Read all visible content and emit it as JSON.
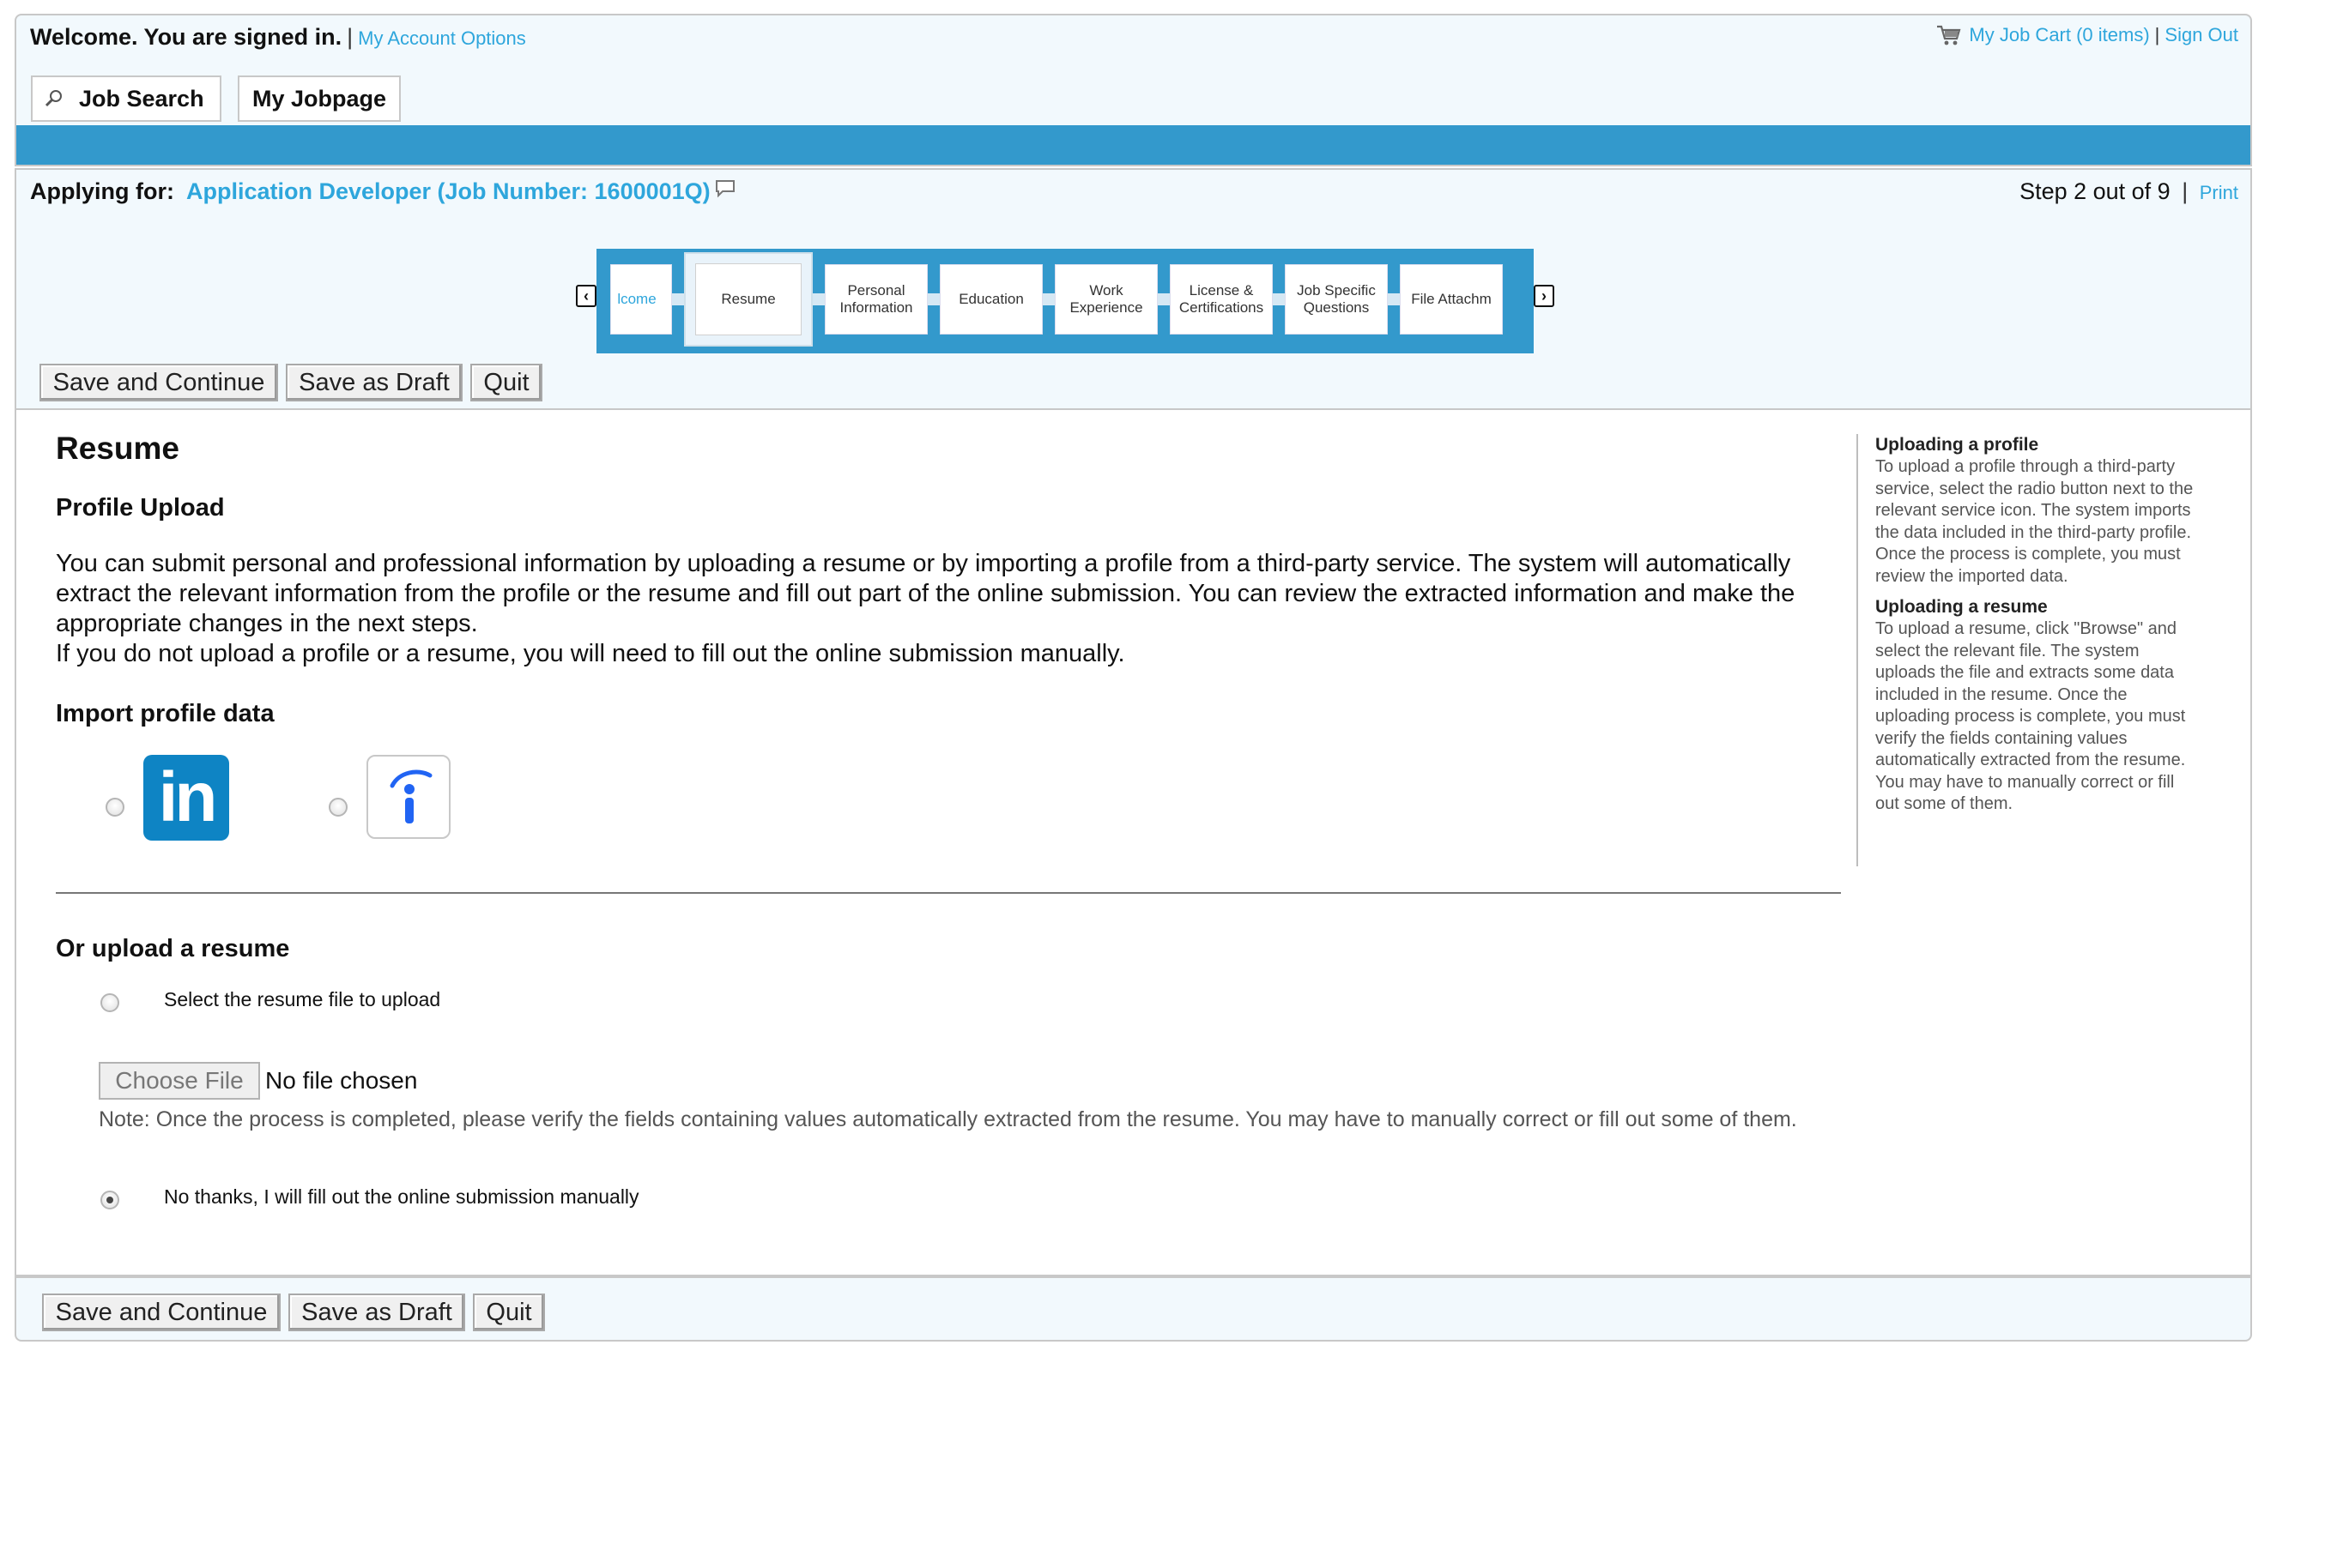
{
  "header": {
    "welcome": "Welcome. You are signed in.",
    "separator": "|",
    "account_options": "My Account Options",
    "job_cart": "My Job Cart (0 items)",
    "sign_out": "Sign Out",
    "tabs": [
      {
        "label": "Job Search",
        "icon": "magnifier-icon"
      },
      {
        "label": "My Jobpage"
      }
    ]
  },
  "apply": {
    "applying_for_label": "Applying for:",
    "job_title": "Application Developer (Job Number: 1600001Q)",
    "step_text": "Step 2 out of 9",
    "print": "Print"
  },
  "stepper": {
    "steps": [
      {
        "label": "lcome",
        "state": "visited"
      },
      {
        "label": "Resume",
        "state": "current"
      },
      {
        "label": "Personal Information"
      },
      {
        "label": "Education"
      },
      {
        "label": "Work Experience"
      },
      {
        "label": "License & Certifications"
      },
      {
        "label": "Job Specific Questions"
      },
      {
        "label": "File Attachm"
      }
    ]
  },
  "buttons": {
    "save_continue": "Save and Continue",
    "save_draft": "Save as Draft",
    "quit": "Quit"
  },
  "main": {
    "title": "Resume",
    "subtitle": "Profile Upload",
    "intro_1": "You can submit personal and professional information by uploading a resume or by importing a profile from a third-party service. The system will automatically extract the relevant information from the profile or the resume and fill out part of the online submission. You can review the extracted information and make the appropriate changes in the next steps.",
    "intro_2": "If you do not upload a profile or a resume, you will need to fill out the online submission manually.",
    "import_title": "Import profile data",
    "linkedin_text": "in",
    "upload_title": "Or upload a resume",
    "upload_option": "Select the resume file to upload",
    "choose_file": "Choose File",
    "no_file": "No file chosen",
    "note": "Note: Once the process is completed, please verify the fields containing values automatically extracted from the resume. You may have to manually correct or fill out some of them.",
    "manual_option": "No thanks, I will fill out the online submission manually"
  },
  "help": {
    "profile_title": "Uploading a profile",
    "profile_text": "To upload a profile through a third-party service, select the radio button next to the relevant service icon. The system imports the data included in the third-party profile. Once the process is complete, you must review the imported data.",
    "resume_title": "Uploading a resume",
    "resume_text": "To upload a resume, click \"Browse\" and select the relevant file. The system uploads the file and extracts some data included in the resume. Once the uploading process is complete, you must verify the fields containing values automatically extracted from the resume. You may have to manually correct or fill out some of them."
  },
  "colors": {
    "accent": "#3399cc",
    "link": "#2ea6dc",
    "linkedin": "#0e84c4",
    "indeed": "#2164f3"
  }
}
